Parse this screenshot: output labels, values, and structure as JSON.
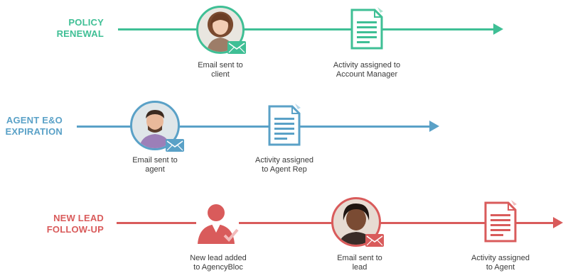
{
  "colors": {
    "green": "#3fbf95",
    "blue": "#5aa1c7",
    "red": "#d95b5b",
    "text": "#3a3a3a"
  },
  "rows": [
    {
      "title": "POLICY\nRENEWAL",
      "steps": [
        {
          "icon": "client-avatar-with-envelope-icon",
          "caption": "Email sent to\nclient"
        },
        {
          "icon": "document-icon",
          "caption": "Activity assigned to\nAccount Manager"
        }
      ]
    },
    {
      "title": "AGENT E&O\nEXPIRATION",
      "steps": [
        {
          "icon": "agent-avatar-with-envelope-icon",
          "caption": "Email sent to\nagent"
        },
        {
          "icon": "document-icon",
          "caption": "Activity assigned\nto Agent Rep"
        }
      ]
    },
    {
      "title": "NEW LEAD\nFOLLOW-UP",
      "steps": [
        {
          "icon": "person-check-icon",
          "caption": "New lead added\nto AgencyBloc"
        },
        {
          "icon": "lead-avatar-with-envelope-icon",
          "caption": "Email sent to\nlead"
        },
        {
          "icon": "document-icon",
          "caption": "Activity assigned\nto Agent"
        }
      ]
    }
  ]
}
